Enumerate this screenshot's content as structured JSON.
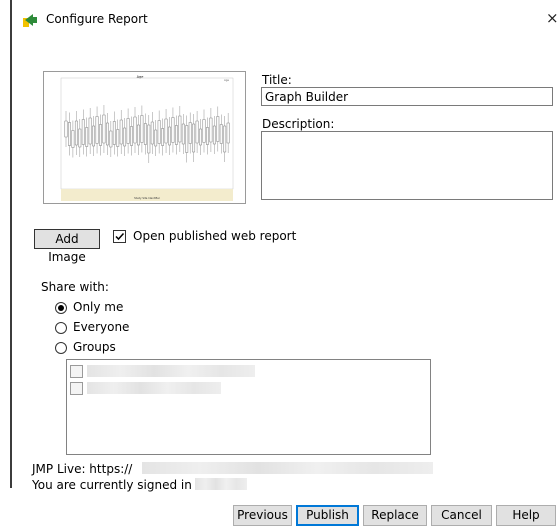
{
  "window": {
    "title": "Configure Report",
    "close_glyph": "×"
  },
  "preview": {
    "chart_title": "Age",
    "legend": "Age",
    "xlabel": "Study Site Identifier"
  },
  "form": {
    "title_label": "Title:",
    "title_value": "Graph Builder",
    "description_label": "Description:",
    "description_value": ""
  },
  "actions": {
    "add_image": "Add Image",
    "open_published_label": "Open published web report",
    "open_published_checked": true
  },
  "share": {
    "label": "Share with:",
    "options": [
      "Only me",
      "Everyone",
      "Groups"
    ],
    "selected": "Only me"
  },
  "info": {
    "jmp_live": "JMP Live: https://",
    "signed_in": "You are currently signed in as"
  },
  "buttons": {
    "previous": "Previous",
    "publish": "Publish",
    "replace": "Replace",
    "cancel": "Cancel",
    "help": "Help"
  },
  "icons": {
    "app": "jmp-arrow-icon",
    "close": "close-icon",
    "check": "checkmark-icon"
  },
  "colors": {
    "accent": "#0078d7",
    "icon_green": "#2e8b3a",
    "icon_yellow": "#f2c200"
  }
}
